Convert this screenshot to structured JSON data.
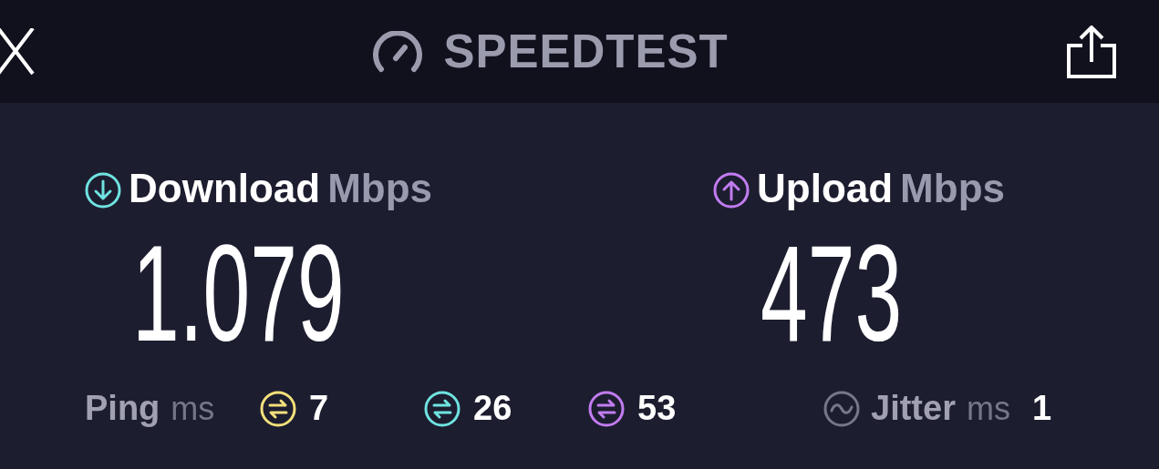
{
  "header": {
    "title": "SPEEDTEST"
  },
  "download": {
    "label": "Download",
    "unit": "Mbps",
    "value": "1.079"
  },
  "upload": {
    "label": "Upload",
    "unit": "Mbps",
    "value": "473"
  },
  "ping": {
    "label": "Ping",
    "unit": "ms",
    "values": [
      {
        "value": "7",
        "color": "#f3e07a"
      },
      {
        "value": "26",
        "color": "#6fe3e0"
      },
      {
        "value": "53",
        "color": "#c27cf0"
      }
    ]
  },
  "jitter": {
    "label": "Jitter",
    "unit": "ms",
    "value": "1"
  }
}
